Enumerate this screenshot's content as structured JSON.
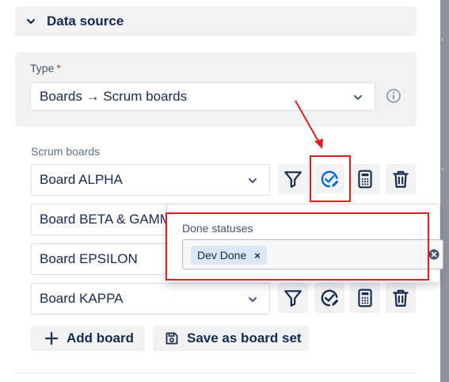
{
  "section": {
    "title": "Data source"
  },
  "type_field": {
    "label": "Type",
    "required_mark": "*",
    "value": "Boards → Scrum boards"
  },
  "scrum_boards": {
    "label": "Scrum boards",
    "boards": [
      {
        "name": "Board ALPHA"
      },
      {
        "name": "Board BETA & GAMMA"
      },
      {
        "name": "Board EPSILON"
      },
      {
        "name": "Board KAPPA"
      }
    ]
  },
  "popover": {
    "label": "Done statuses",
    "tags": [
      {
        "label": "Dev Done",
        "remove": "×"
      }
    ]
  },
  "footer": {
    "add_board": "Add board",
    "save_board_set": "Save as board set"
  },
  "icons": {
    "filter": "filter-icon",
    "done_status": "check-circle-pencil-icon",
    "calculator": "calculator-icon",
    "delete": "trash-icon",
    "info": "info-icon",
    "add": "plus-icon",
    "save": "save-icon"
  },
  "colors": {
    "accent": "#0c66e4",
    "annotation": "#e01e1e",
    "panel_bg": "#f1f2f4",
    "tag_bg": "#dbe7f7"
  }
}
